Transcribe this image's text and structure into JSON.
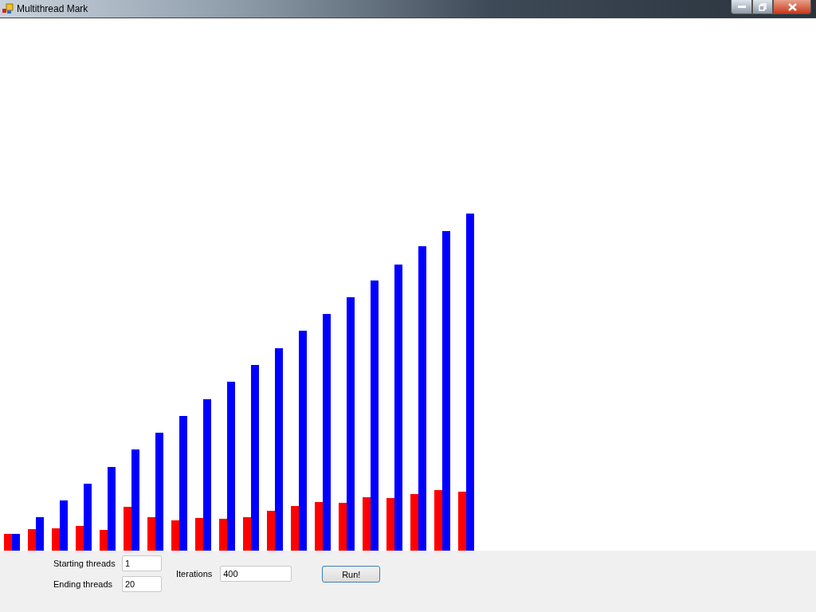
{
  "window": {
    "title": "Multithread Mark"
  },
  "controls": {
    "starting_threads": {
      "label": "Starting threads",
      "value": "1"
    },
    "ending_threads": {
      "label": "Ending threads",
      "value": "20"
    },
    "iterations": {
      "label": "Iterations",
      "value": "400"
    },
    "run_button": {
      "label": "Run!"
    }
  }
}
